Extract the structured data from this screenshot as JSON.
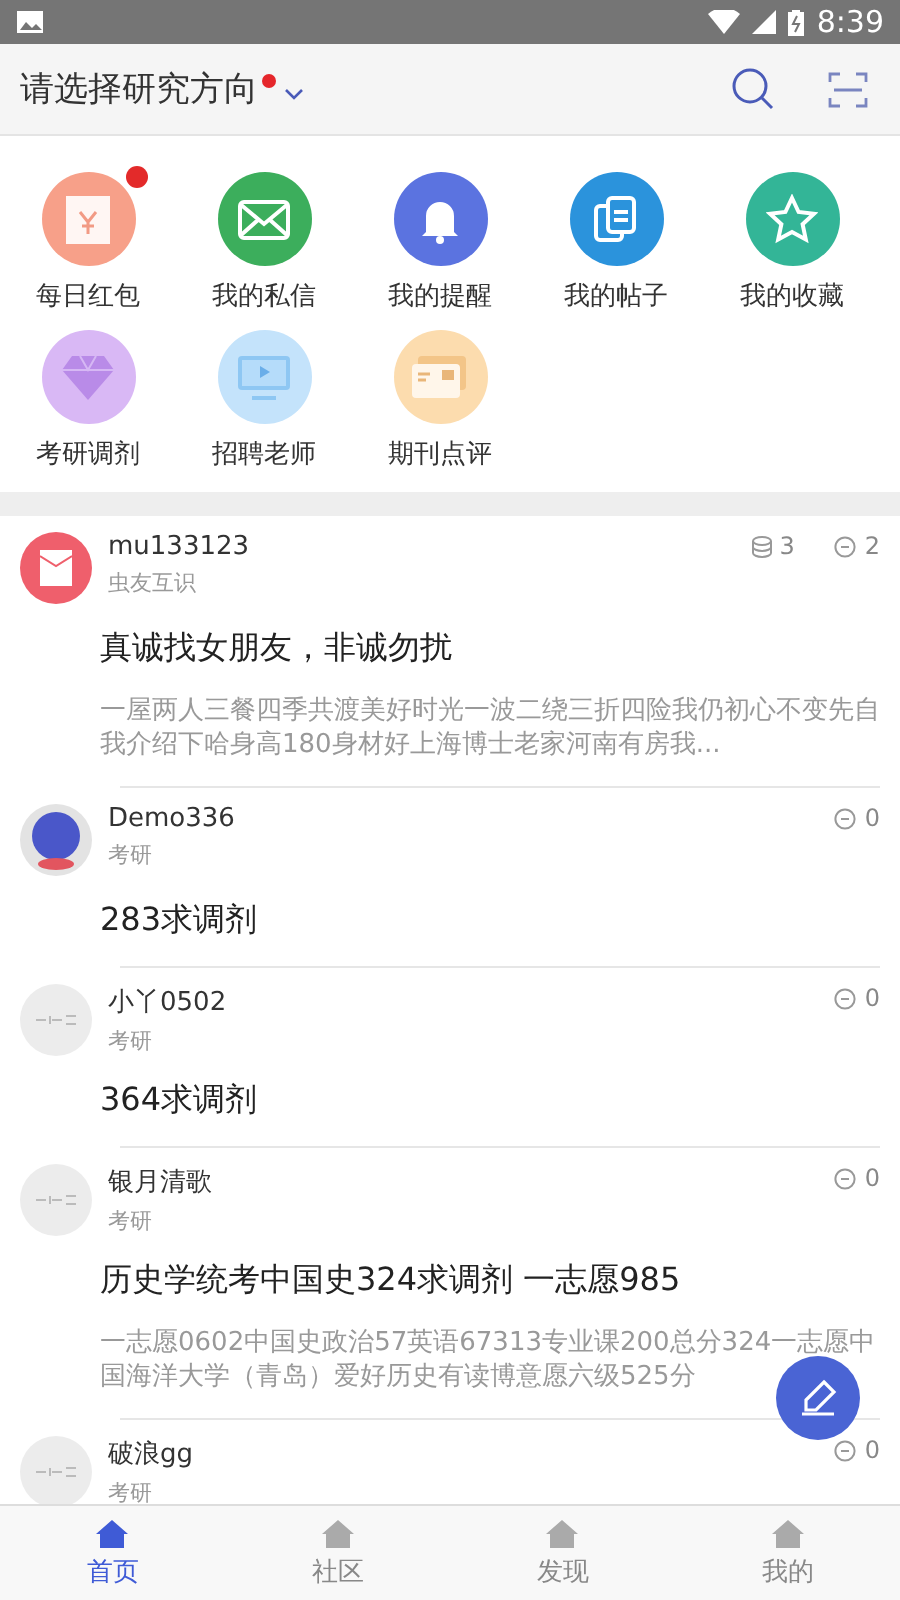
{
  "status_bar": {
    "time": "8:39"
  },
  "header": {
    "title": "请选择研究方向",
    "has_dot": true
  },
  "shortcuts": [
    {
      "label": "每日红包",
      "kind": "envelope",
      "color": "#f7a089",
      "badge": true
    },
    {
      "label": "我的私信",
      "kind": "mail",
      "color": "#3cae5c",
      "badge": false
    },
    {
      "label": "我的提醒",
      "kind": "bell",
      "color": "#5b73e0",
      "badge": false
    },
    {
      "label": "我的帖子",
      "kind": "docs",
      "color": "#2b93dc",
      "badge": false
    },
    {
      "label": "我的收藏",
      "kind": "star",
      "color": "#33b597",
      "badge": false
    },
    {
      "label": "考研调剂",
      "kind": "diamond",
      "color": "#d9b8f5",
      "badge": false
    },
    {
      "label": "招聘老师",
      "kind": "monitor",
      "color": "#c4e3fb",
      "badge": false
    },
    {
      "label": "期刊点评",
      "kind": "card",
      "color": "#fcdcae",
      "badge": false
    }
  ],
  "posts": [
    {
      "kind": "packet",
      "user": "mu133123",
      "board": "虫友互识",
      "coins": "3",
      "comments": "2",
      "title": "真诚找女朋友，非诚勿扰",
      "excerpt": "一屋两人三餐四季共渡美好时光一波二绕三折四险我仍初心不变先自我介绍下哈身高180身材好上海博士老家河南有房我..."
    },
    {
      "kind": "globe",
      "user": "Demo336",
      "board": "考研",
      "comments": "0",
      "title": "283求调剂"
    },
    {
      "kind": "plain",
      "user": "小丫0502",
      "board": "考研",
      "comments": "0",
      "title": "364求调剂"
    },
    {
      "kind": "plain",
      "user": "银月清歌",
      "board": "考研",
      "comments": "0",
      "title": "历史学统考中国史324求调剂 一志愿985",
      "excerpt": "一志愿0602中国史政治57英语67313专业课200总分324一志愿中国海洋大学（青岛）爱好历史有读博意愿六级525分"
    },
    {
      "kind": "plain",
      "user": "破浪gg",
      "board": "考研",
      "comments": "0"
    }
  ],
  "tabs": [
    {
      "label": "首页",
      "selected": true
    },
    {
      "label": "社区",
      "selected": false
    },
    {
      "label": "发现",
      "selected": false
    },
    {
      "label": "我的",
      "selected": false
    }
  ]
}
